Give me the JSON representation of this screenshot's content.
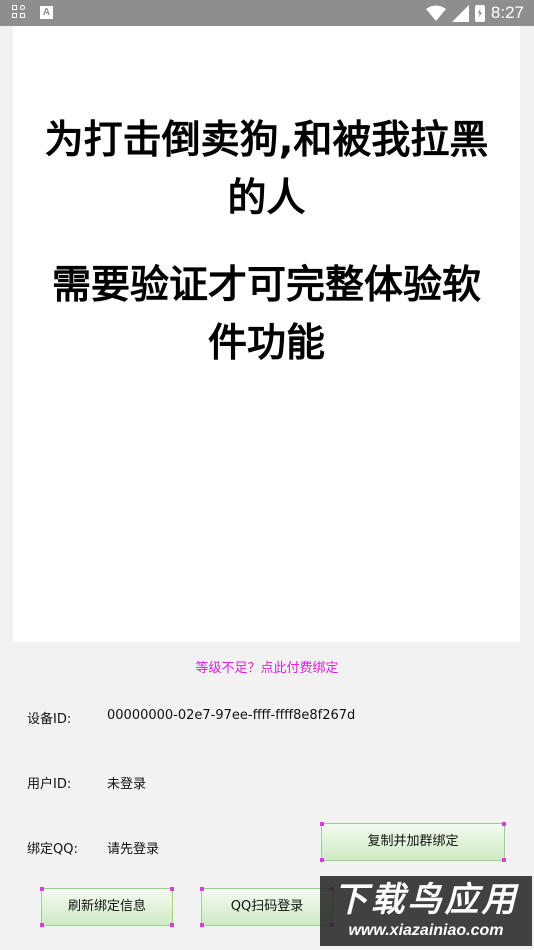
{
  "status_bar": {
    "time": "8:27",
    "icons": [
      "grid-icon",
      "a-icon",
      "wifi-icon",
      "signal-icon",
      "battery-charging-icon"
    ],
    "color": "#8e8e8e"
  },
  "notice": {
    "line1": "为打击倒卖狗,和被我拉黑的人",
    "line2": "需要验证才可完整体验软件功能"
  },
  "pay_link": {
    "text": "等级不足？点此付费绑定",
    "color": "#e020e0"
  },
  "info": {
    "device_label": "设备ID:",
    "device_value": "00000000-02e7-97ee-ffff-ffff8e8f267d",
    "user_label": "用户ID:",
    "user_value": "未登录",
    "qq_label": "绑定QQ:",
    "qq_value": "请先登录"
  },
  "buttons": {
    "copy_label": "复制并加群绑定",
    "refresh_label": "刷新绑定信息",
    "qq_login_label": "QQ扫码登录"
  },
  "watermark": {
    "top": "下载鸟应用",
    "bottom": "www.xiazainiao.com"
  }
}
